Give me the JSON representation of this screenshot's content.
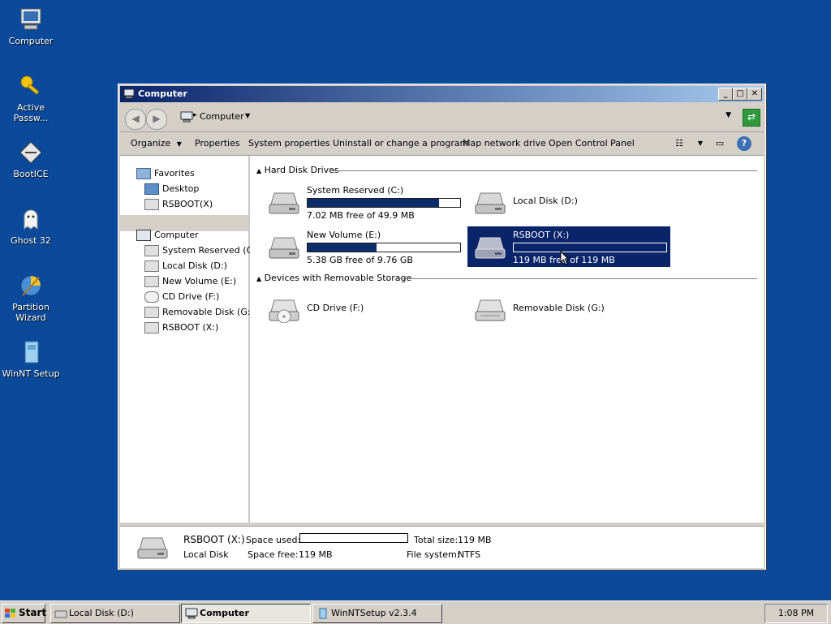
{
  "desktop": {
    "icons": [
      {
        "label": "Computer",
        "icon": "computer-icon"
      },
      {
        "label": "Active Passw...",
        "icon": "key-icon"
      },
      {
        "label": "BootICE",
        "icon": "bootice-icon"
      },
      {
        "label": "Ghost 32",
        "icon": "ghost-icon"
      },
      {
        "label": "Partition Wizard",
        "icon": "partition-wizard-icon"
      },
      {
        "label": "WinNT Setup",
        "icon": "winnt-setup-icon"
      }
    ]
  },
  "window": {
    "title": "Computer",
    "controls": {
      "minimize": "_",
      "maximize": "□",
      "close": "✕"
    },
    "address": {
      "crumb": "Computer",
      "separator": "▸"
    },
    "toolbar": {
      "organize": "Organize",
      "properties": "Properties",
      "system_properties": "System properties",
      "uninstall": "Uninstall or change a program",
      "map_drive": "Map network drive",
      "control_panel": "Open Control Panel"
    },
    "nav": {
      "favorites": "Favorites",
      "desktop": "Desktop",
      "rsboot_fav": "RSBOOT(X)",
      "computer": "Computer",
      "drives": [
        "System Reserved (C:)",
        "Local Disk (D:)",
        "New Volume (E:)",
        "CD Drive (F:)",
        "Removable Disk (G:)",
        "RSBOOT (X:)"
      ]
    },
    "groups": {
      "hdd": "Hard Disk Drives",
      "removable": "Devices with Removable Storage"
    },
    "drives": {
      "c": {
        "name": "System Reserved (C:)",
        "free": "7.02 MB free of 49.9 MB",
        "used_fraction": 0.86
      },
      "d": {
        "name": "Local Disk (D:)"
      },
      "e": {
        "name": "New Volume (E:)",
        "free": "5.38 GB free of 9.76 GB",
        "used_fraction": 0.45
      },
      "x": {
        "name": "RSBOOT (X:)",
        "free": "119 MB free of 119 MB",
        "used_fraction": 0.0
      },
      "f": {
        "name": "CD Drive (F:)"
      },
      "g": {
        "name": "Removable Disk (G:)"
      }
    },
    "details": {
      "name": "RSBOOT (X:)",
      "type": "Local Disk",
      "space_used_label": "Space used:",
      "space_free_label": "Space free:",
      "space_free": "119 MB",
      "total_size_label": "Total size:",
      "total_size": "119 MB",
      "fs_label": "File system:",
      "fs": "NTFS"
    }
  },
  "taskbar": {
    "start": "Start",
    "tasks": [
      "Local Disk (D:)",
      "Computer",
      "WinNTSetup v2.3.4"
    ],
    "clock": "1:08 PM"
  }
}
